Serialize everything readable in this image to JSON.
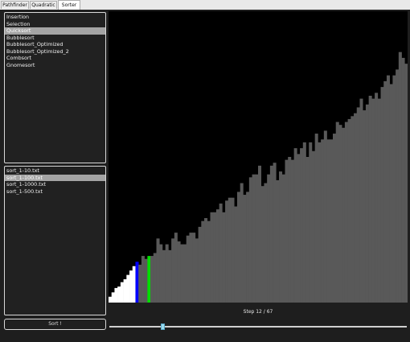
{
  "tabs": [
    {
      "label": "Pathfinder",
      "active": false
    },
    {
      "label": "Quadratic",
      "active": false
    },
    {
      "label": "Sorter",
      "active": true
    }
  ],
  "algorithms": {
    "items": [
      "Insertion",
      "Selection",
      "Quicksort",
      "Bubblesort",
      "Bubblesort_Optimized",
      "Bubblesort_Optimized_2",
      "Combsort",
      "Gnomesort"
    ],
    "selected_index": 2
  },
  "files": {
    "items": [
      "sort_1-10.txt",
      "sort_1-100.txt",
      "sort_1-1000.txt",
      "sort_1-500.txt"
    ],
    "selected_index": 1
  },
  "sort_button": {
    "label": "Sort !"
  },
  "step": {
    "text": "Step 12 / 67",
    "current": 12,
    "total": 67
  },
  "slider": {
    "value_fraction": 0.18
  },
  "colors": {
    "sorted": "#ffffff",
    "unsorted": "#595959",
    "pivot": "#0000ff",
    "compare": "#00dd00",
    "background": "#000000"
  },
  "chart_data": {
    "type": "bar",
    "values": [
      4,
      7,
      10,
      11,
      14,
      16,
      19,
      22,
      25,
      28,
      26,
      32,
      30,
      32,
      32,
      34,
      44,
      40,
      36,
      40,
      36,
      44,
      48,
      42,
      40,
      40,
      46,
      48,
      48,
      44,
      52,
      56,
      58,
      56,
      62,
      62,
      64,
      68,
      62,
      70,
      72,
      72,
      66,
      76,
      82,
      74,
      76,
      86,
      88,
      88,
      94,
      80,
      82,
      88,
      94,
      96,
      84,
      90,
      88,
      98,
      100,
      98,
      106,
      102,
      106,
      110,
      100,
      110,
      104,
      116,
      110,
      112,
      118,
      112,
      112,
      116,
      124,
      122,
      120,
      124,
      126,
      128,
      130,
      134,
      140,
      132,
      136,
      142,
      140,
      144,
      140,
      148,
      152,
      156,
      150,
      156,
      160,
      172,
      168,
      164
    ],
    "highlights": [
      {
        "index": 9,
        "role": "pivot"
      },
      {
        "index": 13,
        "role": "compare"
      }
    ],
    "sorted_count": 9,
    "ylim": [
      0,
      200
    ]
  }
}
